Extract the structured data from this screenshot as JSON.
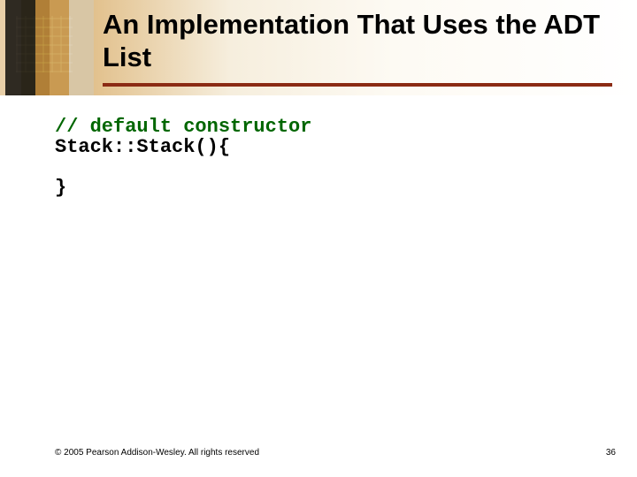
{
  "title": "An Implementation That Uses the ADT List",
  "code": {
    "comment": "// default constructor",
    "line1": "Stack::Stack(){",
    "blank": "",
    "line2": "}"
  },
  "footer": {
    "copyright": "© 2005 Pearson Addison-Wesley. All rights reserved",
    "page": "36"
  }
}
